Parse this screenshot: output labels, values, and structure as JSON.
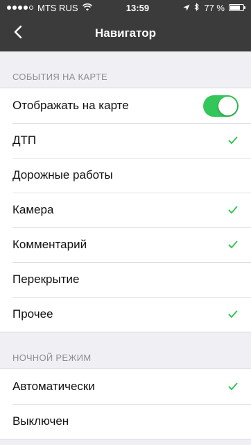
{
  "status_bar": {
    "carrier": "MTS RUS",
    "time": "13:59",
    "battery": "77 %",
    "battery_level": 0.77
  },
  "nav": {
    "title": "Навигатор"
  },
  "sections": [
    {
      "header": "СОБЫТИЯ НА КАРТЕ",
      "rows": [
        {
          "label": "Отображать на карте",
          "toggle_on": true
        },
        {
          "label": "ДТП",
          "checked": true
        },
        {
          "label": "Дорожные работы",
          "checked": false
        },
        {
          "label": "Камера",
          "checked": true
        },
        {
          "label": "Комментарий",
          "checked": true
        },
        {
          "label": "Перекрытие",
          "checked": false
        },
        {
          "label": "Прочее",
          "checked": true
        }
      ]
    },
    {
      "header": "НОЧНОЙ РЕЖИМ",
      "rows": [
        {
          "label": "Автоматически",
          "checked": true
        },
        {
          "label": "Выключен",
          "checked": false
        }
      ]
    }
  ],
  "colors": {
    "accent_green": "#33c759",
    "bar_bg": "#3b3b3b",
    "page_bg": "#efeff4"
  }
}
